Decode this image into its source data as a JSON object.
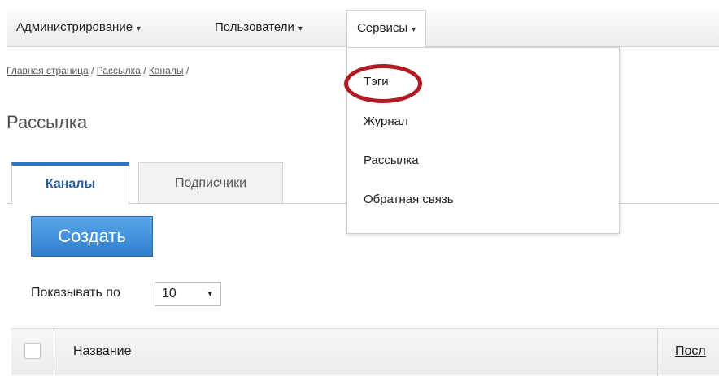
{
  "menu": {
    "items": [
      {
        "label": "Администрирование"
      },
      {
        "label": "Пользователи"
      },
      {
        "label": "Сервисы"
      }
    ],
    "caret": "▾"
  },
  "services_dropdown": {
    "items": [
      {
        "label": "Тэги"
      },
      {
        "label": "Журнал"
      },
      {
        "label": "Рассылка"
      },
      {
        "label": "Обратная связь"
      }
    ],
    "highlight_color": "#b01a22"
  },
  "breadcrumb": {
    "items": [
      "Главная страница",
      "Рассылка",
      "Каналы"
    ],
    "separator": "/"
  },
  "page_title": "Рассылка",
  "tabs": [
    {
      "label": "Каналы",
      "active": true
    },
    {
      "label": "Подписчики",
      "active": false
    }
  ],
  "toolbar": {
    "create_label": "Создать"
  },
  "pagination": {
    "show_label": "Показывать по",
    "page_size": "10",
    "caret": "▾"
  },
  "table": {
    "columns": [
      {
        "label": "Название"
      },
      {
        "label": "Посл"
      }
    ]
  },
  "colors": {
    "accent": "#2b73c7",
    "button": "#3a8ad8",
    "highlight": "#b01a22"
  }
}
